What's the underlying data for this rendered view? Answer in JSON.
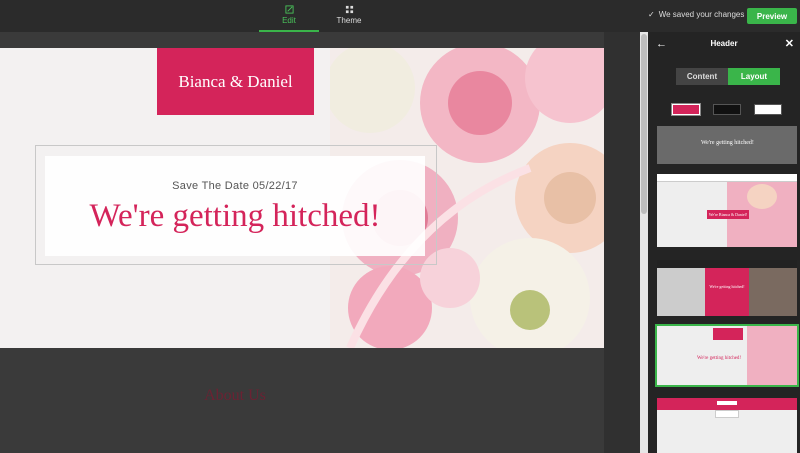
{
  "topbar": {
    "tabs": [
      {
        "label": "Edit",
        "icon": "edit-icon",
        "active": true
      },
      {
        "label": "Theme",
        "icon": "theme-icon",
        "active": false
      }
    ],
    "saved_text": "We saved your changes",
    "preview_label": "Preview"
  },
  "hero": {
    "brand": "Bianca & Daniel",
    "save_the_date": "Save The Date 05/22/17",
    "headline": "We're getting hitched!"
  },
  "section": {
    "about_title": "About Us"
  },
  "panel": {
    "title": "Header",
    "tabs": [
      {
        "label": "Content",
        "active": false
      },
      {
        "label": "Layout",
        "active": true
      }
    ],
    "color_swatches": [
      "#d4245a",
      "#111111",
      "#ffffff"
    ],
    "layouts": [
      {
        "text": "We're getting hitched!"
      },
      {
        "text": "We're Bianca & Daniel!"
      },
      {
        "text": "We're getting hitched!"
      },
      {
        "text": "We're getting hitched!"
      }
    ]
  },
  "colors": {
    "accent": "#d4245a",
    "green": "#3ab54a"
  }
}
